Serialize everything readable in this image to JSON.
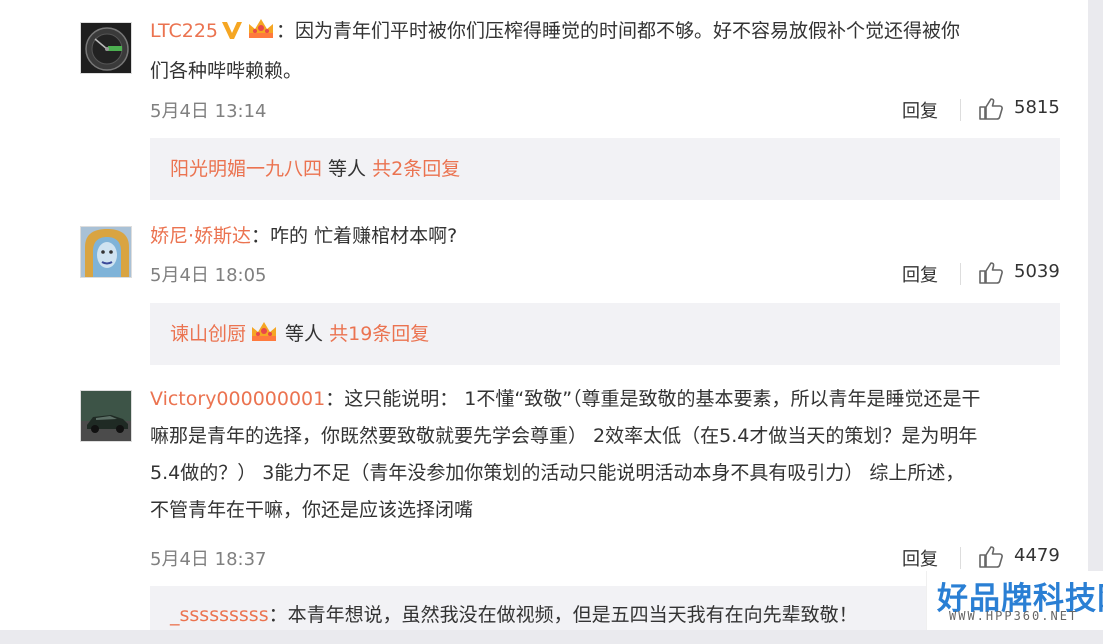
{
  "colors": {
    "username": "#eb7350",
    "link": "#eb7350",
    "text": "#333333",
    "meta": "#808080",
    "sub_bg": "#f2f2f5",
    "verified": "#f5a623",
    "watermark": "#2a7fd4"
  },
  "comments": [
    {
      "username": "LTC225",
      "badges": [
        "verified-v-icon",
        "vip-crown-icon"
      ],
      "text_line1": "：因为青年们平时被你们压榨得睡觉的时间都不够。好不容易放假补个觉还得被你",
      "text_line2": "们各种哔哔赖赖。",
      "date": "5月4日 13:14",
      "reply_label": "回复",
      "likes": "5815",
      "sub": {
        "names": "阳光明媚一九八四",
        "others": " 等人 ",
        "total": "共2条回复"
      }
    },
    {
      "username": "娇尼·娇斯达",
      "text": "：咋的 忙着赚棺材本啊?",
      "date": "5月4日 18:05",
      "reply_label": "回复",
      "likes": "5039",
      "sub": {
        "names": "谏山创厨",
        "others": " 等人 ",
        "total": "共19条回复"
      }
    },
    {
      "username": "Victory000000001",
      "text_line1": "：这只能说明： 1不懂“致敬”（尊重是致敬的基本要素，所以青年是睡觉还是干",
      "text_line2": "嘛那是青年的选择，你既然要致敬就要先学会尊重） 2效率太低（在5.4才做当天的策划？是为明年",
      "text_line3": "5.4做的？） 3能力不足（青年没参加你策划的活动只能说明活动本身不具有吸引力） 综上所述，",
      "text_line4": "不管青年在干嘛，你还是应该选择闭嘴",
      "date": "5月4日 18:37",
      "reply_label": "回复",
      "likes": "4479",
      "sub": {
        "username": "_sssssssss",
        "text": "：本青年想说，虽然我没在做视频，但是五四当天我有在向先辈致敬！"
      }
    }
  ],
  "watermark": {
    "main": "好品牌科技网",
    "sub": "WWW.HPP360.NET"
  }
}
